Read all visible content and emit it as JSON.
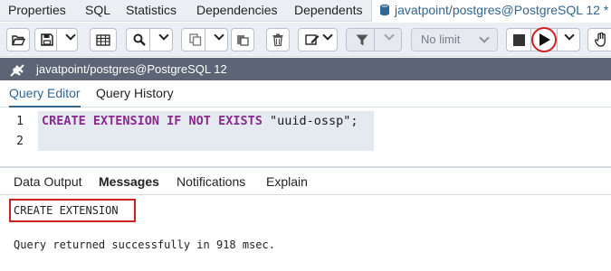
{
  "top_tabs": {
    "properties": "Properties",
    "sql": "SQL",
    "statistics": "Statistics",
    "dependencies": "Dependencies",
    "dependents": "Dependents",
    "query_tool": "javatpoint/postgres@PostgreSQL 12 *"
  },
  "toolbar": {
    "limit_label": "No limit",
    "icons": [
      "open-folder-icon",
      "save-icon",
      "chevron-down-icon",
      "grid-icon",
      "search-icon",
      "chevron-down-icon",
      "copy-icon",
      "chevron-down-icon",
      "paste-icon",
      "delete-icon",
      "edit-icon",
      "chevron-down-icon",
      "filter-icon",
      "chevron-down-icon",
      "stop-icon",
      "execute-icon",
      "chevron-down-icon",
      "hand-icon"
    ]
  },
  "connection": {
    "label": "javatpoint/postgres@PostgreSQL 12"
  },
  "query_tabs": {
    "editor": "Query Editor",
    "history": "Query History"
  },
  "editor": {
    "line_numbers": [
      "1",
      "2"
    ],
    "line1": {
      "keywords": "CREATE EXTENSION IF NOT EXISTS ",
      "string": "\"uuid-ossp\";"
    }
  },
  "result_tabs": {
    "data_output": "Data Output",
    "messages": "Messages",
    "notifications": "Notifications",
    "explain": "Explain"
  },
  "messages": {
    "line1": "CREATE EXTENSION",
    "line2": "Query returned successfully in 918 msec."
  },
  "colors": {
    "accent": "#326690",
    "keyword": "#8a2a8e",
    "highlight": "#cc2222",
    "connection_bar": "#5b6575"
  }
}
